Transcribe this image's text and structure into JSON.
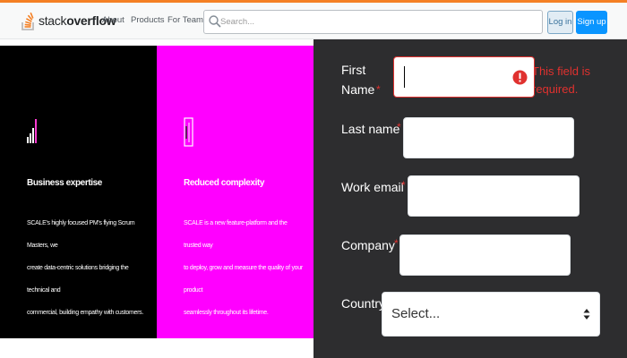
{
  "header": {
    "logo": {
      "light": "stack",
      "bold": "overflow"
    },
    "nav": [
      "About",
      "Products",
      "For Teams"
    ],
    "search_placeholder": "Search...",
    "login": "Log in",
    "signup": "Sign up"
  },
  "features": [
    {
      "icon": "bar-chart-icon",
      "title": "Business expertise",
      "lines": [
        "SCALE's highly focused PM's flying Scrum Masters, we",
        "create data-centric solutions bridging the technical and",
        "commercial, building empathy with customers."
      ]
    },
    {
      "icon": "document-icon",
      "title": "Reduced complexity",
      "lines": [
        "SCALE is a new feature-platform and the trusted way",
        "to deploy, grow and measure the quality of your product",
        "seamlessly throughout its lifetime."
      ]
    }
  ],
  "form": {
    "first_name": {
      "label": "First Name",
      "value": "",
      "error": "This field is required."
    },
    "last_name": {
      "label": "Last name",
      "value": ""
    },
    "work_email": {
      "label": "Work email",
      "value": ""
    },
    "company": {
      "label": "Company",
      "value": ""
    },
    "country": {
      "label": "Country",
      "selected": "Select..."
    },
    "required_marker": "*"
  },
  "colors": {
    "brand_orange": "#f48024",
    "button_blue": "#0a95ff",
    "panel_black": "#000000",
    "panel_magenta": "#ff00ff",
    "form_bg": "#2d2d2f",
    "error_red": "#e0312f"
  }
}
